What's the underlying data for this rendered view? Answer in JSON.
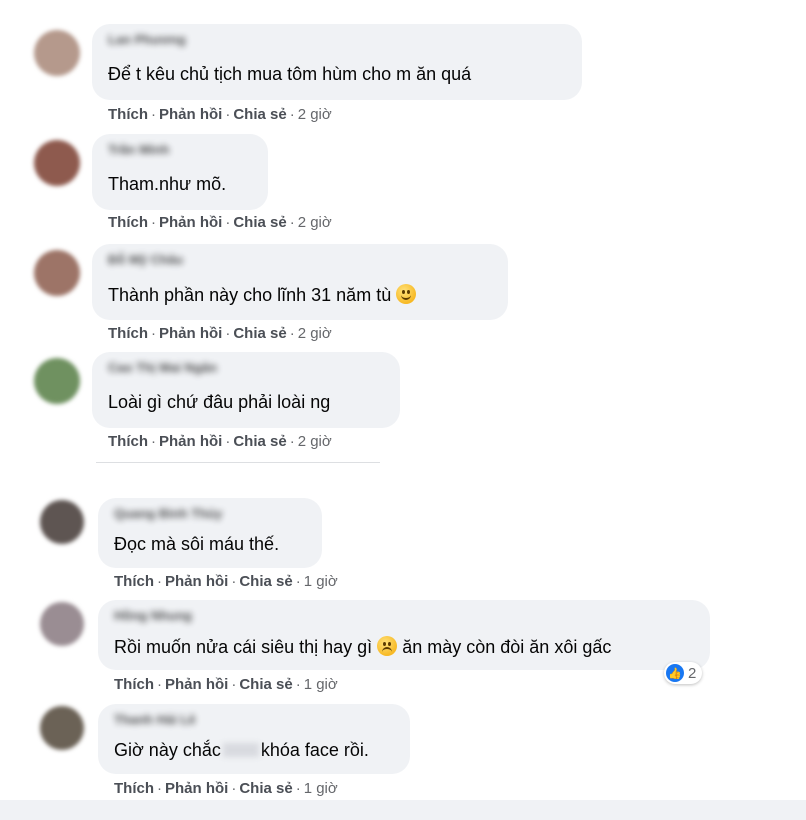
{
  "action_labels": {
    "like": "Thích",
    "reply": "Phản hồi",
    "share": "Chia sẻ",
    "sep": "·"
  },
  "comments": [
    {
      "name": "Lan Phương",
      "text": "Để t kêu chủ tịch mua tôm hùm cho m ăn quá",
      "time": "2 giờ"
    },
    {
      "name": "Trần Minh",
      "text": "Tham.như mõ.",
      "time": "2 giờ"
    },
    {
      "name": "Đỗ Mỹ Châu",
      "text": "Thành phần này cho lĩnh 31 năm tù",
      "emoji": "smile-emoji",
      "time": "2 giờ"
    },
    {
      "name": "Cao Thị Mai Ngân",
      "text": "Loài gì chứ đâu phải loài ng",
      "time": "2 giờ"
    },
    {
      "name": "Quang Bình Thủy",
      "text": "Đọc mà sôi máu thế.",
      "time": "1 giờ"
    },
    {
      "name": "Hồng Nhung",
      "text_before": "Rồi muốn nửa cái siêu thị hay gì",
      "emoji": "frown-emoji",
      "text_after": "ăn mày còn đòi ăn xôi gấc",
      "reaction_count": "2",
      "reaction_icon": "like-icon",
      "time": "1 giờ"
    },
    {
      "name": "Thanh Hải Lê",
      "text_before": "Giờ này chắc",
      "text_after": "khóa face rồi.",
      "time": "1 giờ"
    }
  ],
  "colors": {
    "bubble": "#f0f2f5",
    "text": "#050505",
    "meta": "#65676b",
    "like_blue": "#1877f2"
  }
}
